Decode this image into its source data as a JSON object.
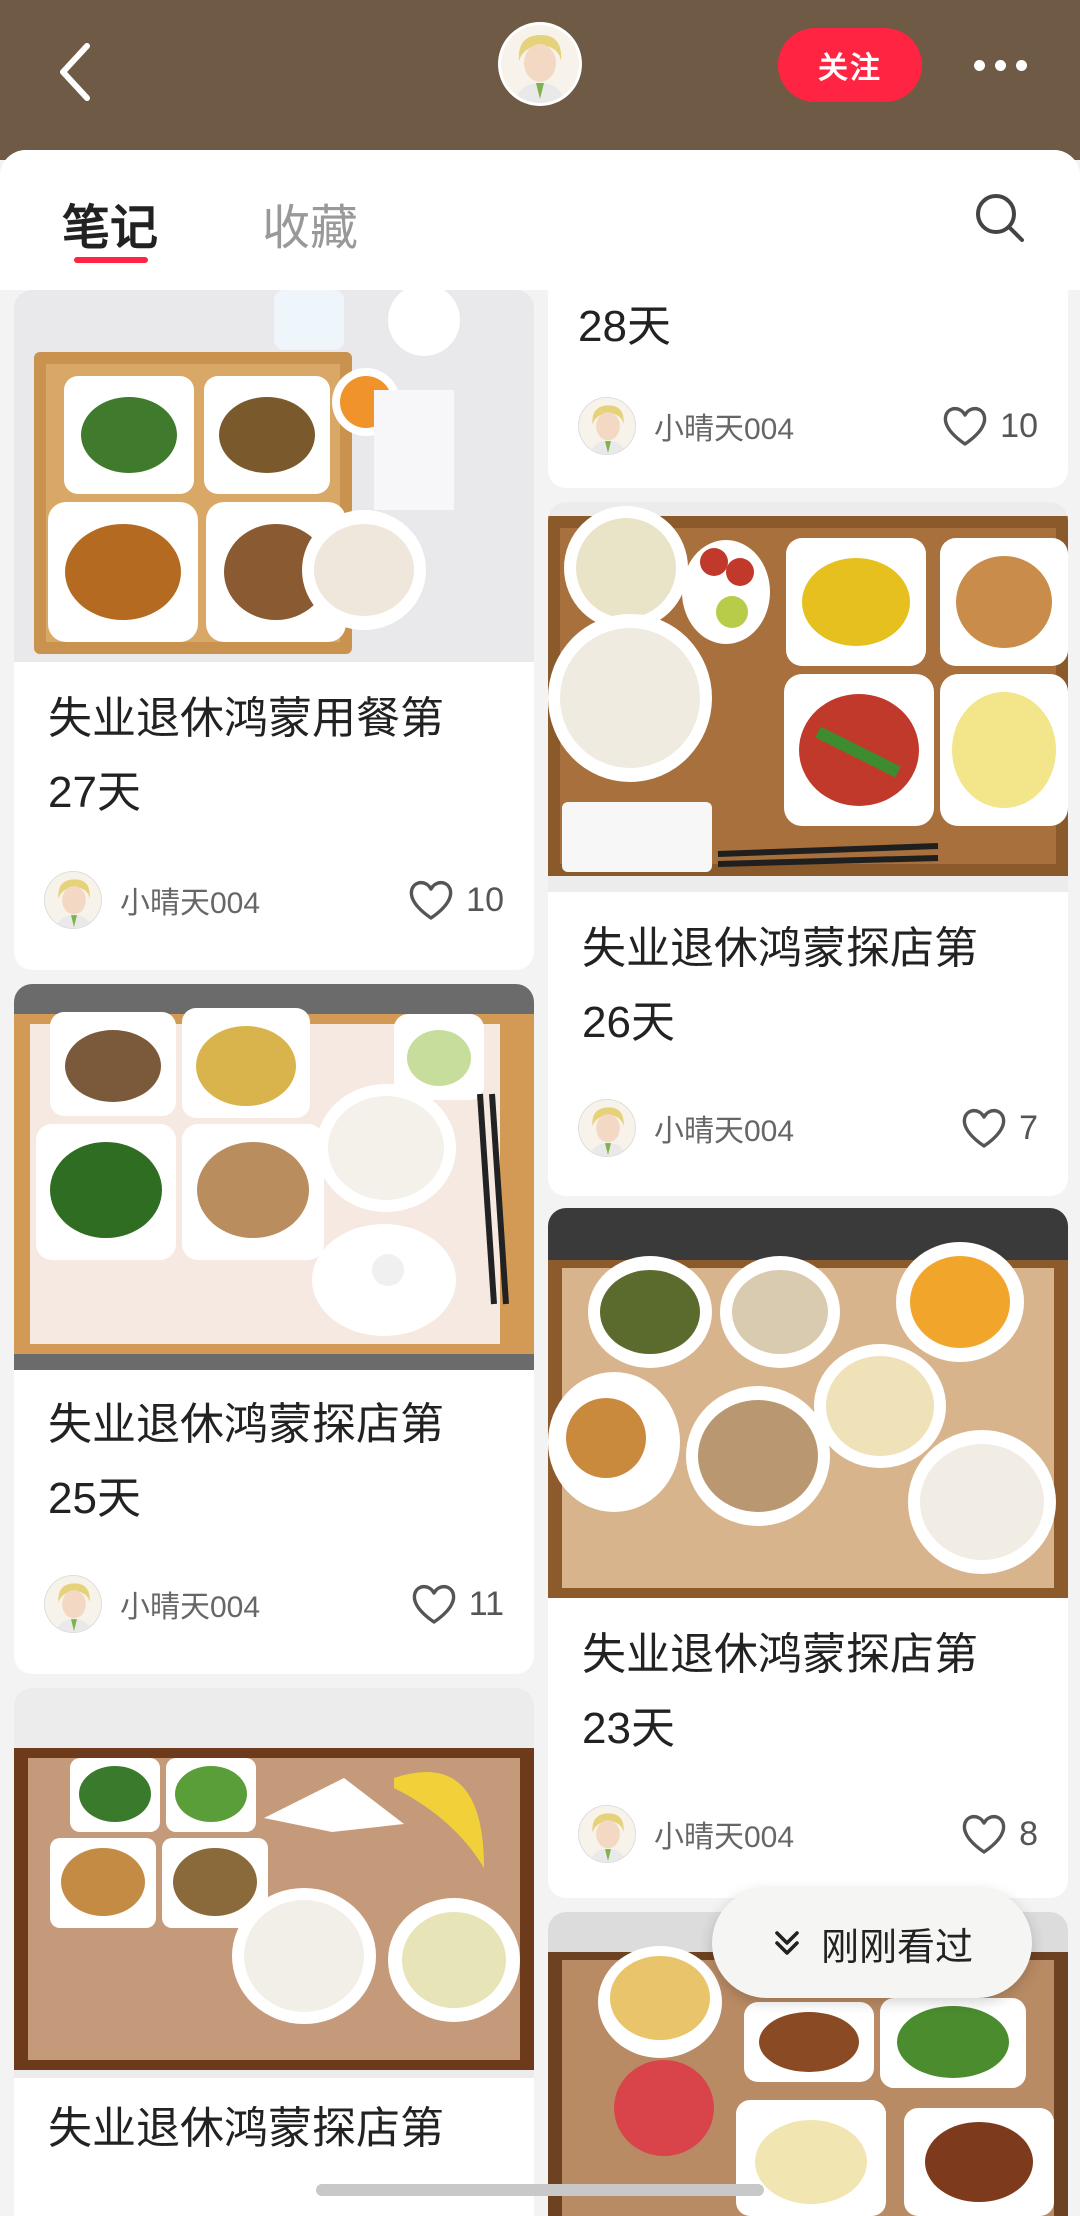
{
  "header": {
    "follow_label": "关注"
  },
  "tabs": [
    {
      "label": "笔记"
    },
    {
      "label": "收藏"
    }
  ],
  "colors": {
    "accent": "#ff2442",
    "header_bg": "#6e5a45"
  },
  "author": "小晴天004",
  "cards": [
    {
      "title_line1": "失业退休鸿蒙用餐第",
      "title_line2": "27天",
      "author": "小晴天004",
      "likes": "10"
    },
    {
      "title_line2": "28天",
      "author": "小晴天004",
      "likes": "10"
    },
    {
      "title_line1": "失业退休鸿蒙探店第",
      "title_line2": "26天",
      "author": "小晴天004",
      "likes": "7"
    },
    {
      "title_line1": "失业退休鸿蒙探店第",
      "title_line2": "25天",
      "author": "小晴天004",
      "likes": "11"
    },
    {
      "title_line1": "失业退休鸿蒙探店第",
      "title_line2": "23天",
      "author": "小晴天004",
      "likes": "8"
    },
    {
      "title_line1": "失业退休鸿蒙探店第"
    },
    {}
  ],
  "recent": {
    "label": "刚刚看过"
  }
}
